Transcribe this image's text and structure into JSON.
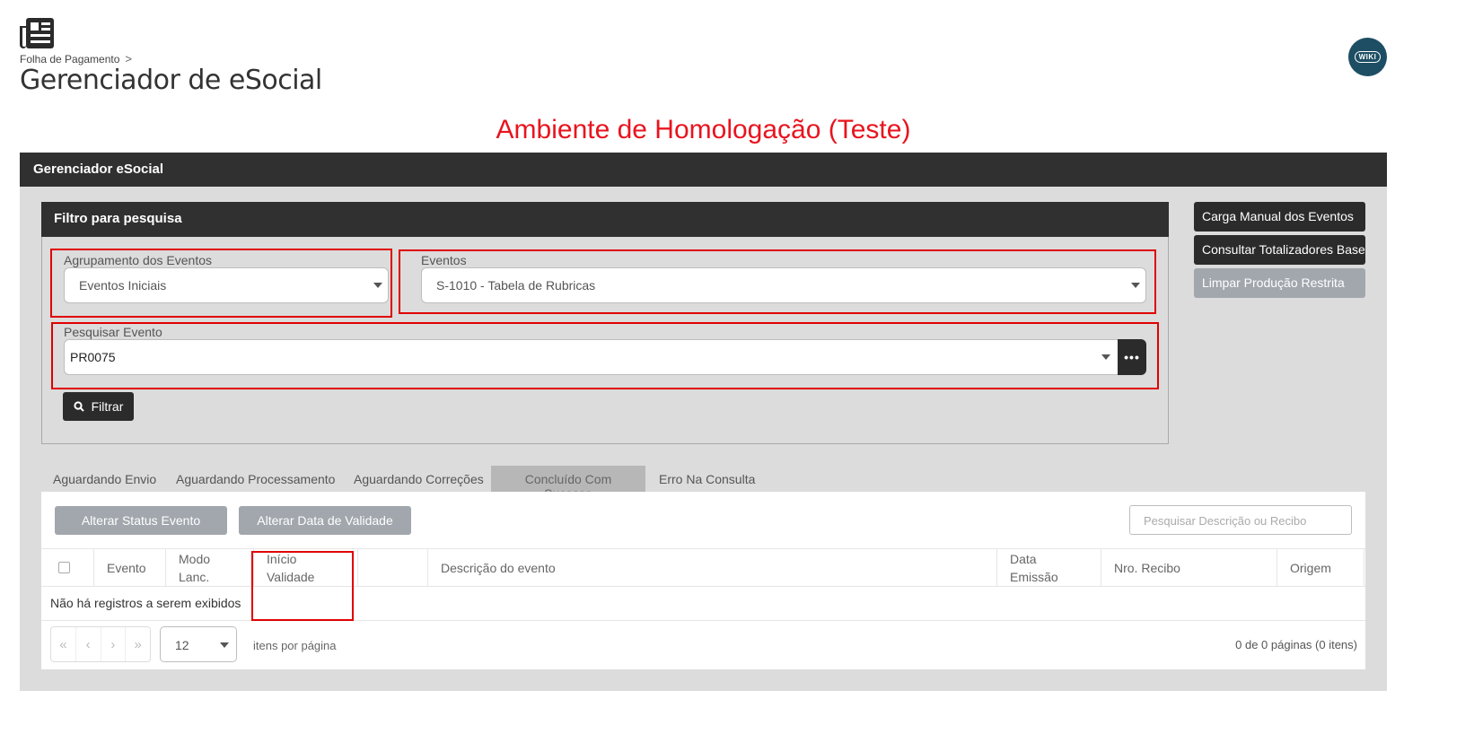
{
  "header": {
    "breadcrumb": "Folha de Pagamento",
    "breadcrumb_separator": ">",
    "title": "Gerenciador de eSocial",
    "wiki_label": "WIKI"
  },
  "environment_banner": "Ambiente de Homologação (Teste)",
  "panel": {
    "title": "Gerenciador eSocial"
  },
  "filter": {
    "title": "Filtro para pesquisa",
    "grouping": {
      "label": "Agrupamento dos Eventos",
      "value": "Eventos Iniciais"
    },
    "events": {
      "label": "Eventos",
      "value": "S-1010 - Tabela de Rubricas"
    },
    "search_event": {
      "label": "Pesquisar Evento",
      "value": "PR0075"
    },
    "filter_button": "Filtrar"
  },
  "side_buttons": {
    "manual_load": "Carga Manual dos Eventos",
    "totalizers": "Consultar Totalizadores Base",
    "clear_restricted": "Limpar Produção Restrita"
  },
  "tabs": [
    {
      "label": "Aguardando Envio",
      "active": false
    },
    {
      "label": "Aguardando Processamento",
      "active": false
    },
    {
      "label": "Aguardando Correções",
      "active": false
    },
    {
      "label": "Concluído Com Sucesso",
      "active": true
    },
    {
      "label": "Erro Na Consulta",
      "active": false
    }
  ],
  "actions": {
    "change_status": "Alterar Status Evento",
    "change_validity": "Alterar Data de Validade",
    "search_placeholder": "Pesquisar Descrição ou Recibo"
  },
  "table": {
    "columns": {
      "evento": "Evento",
      "modo_lanc": "Modo Lanc.",
      "inicio_validade": "Início Validade",
      "descricao": "Descrição do evento",
      "data_emissao": "Data Emissão",
      "nro_recibo": "Nro. Recibo",
      "origem": "Origem"
    },
    "empty_message": "Não há registros a serem exibidos"
  },
  "pagination": {
    "page_size": "12",
    "items_per_page_label": "itens por página",
    "summary": "0 de 0 páginas (0 itens)"
  },
  "colors": {
    "dark_header": "#303030",
    "panel_bg": "#dcdcdc",
    "banner_red": "#e8141e",
    "highlight_red": "#e00000",
    "disabled_button": "#a1a7ad",
    "wiki_bg": "#1e4e63"
  }
}
